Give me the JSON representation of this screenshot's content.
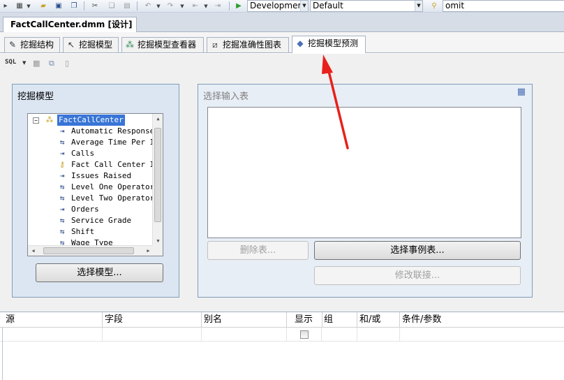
{
  "toolbar": {
    "config_combo": "Developmer",
    "platform_combo": "Default",
    "find_text": "omit"
  },
  "document_tab": {
    "title": "FactCallCenter.dmm [设计]"
  },
  "designer_tabs": [
    {
      "label": "挖掘结构"
    },
    {
      "label": "挖掘模型"
    },
    {
      "label": "挖掘模型查看器"
    },
    {
      "label": "挖掘准确性图表"
    },
    {
      "label": "挖掘模型预测",
      "active": true
    }
  ],
  "sql_toolbar": {
    "sql_label": "SQL"
  },
  "mining_model_panel": {
    "title": "挖掘模型",
    "tree": {
      "root": "FactCallCenter",
      "items": [
        {
          "label": "Automatic Responses",
          "icon": "input-column-icon"
        },
        {
          "label": "Average Time Per Is",
          "icon": "predict-column-icon"
        },
        {
          "label": "Calls",
          "icon": "input-column-icon"
        },
        {
          "label": "Fact Call Center ID",
          "icon": "key-column-icon"
        },
        {
          "label": "Issues Raised",
          "icon": "input-column-icon"
        },
        {
          "label": "Level One Operators",
          "icon": "predict-column-icon"
        },
        {
          "label": "Level Two Operators",
          "icon": "predict-column-icon"
        },
        {
          "label": "Orders",
          "icon": "input-column-icon"
        },
        {
          "label": "Service Grade",
          "icon": "predict-column-icon"
        },
        {
          "label": "Shift",
          "icon": "predict-column-icon"
        },
        {
          "label": "Wage Type",
          "icon": "predict-column-icon"
        }
      ]
    },
    "select_model_button": "选择模型..."
  },
  "input_table_panel": {
    "title": "选择输入表",
    "remove_table_button": "删除表...",
    "select_case_table_button": "选择事例表...",
    "modify_join_button": "修改联接..."
  },
  "grid": {
    "columns": [
      "源",
      "字段",
      "别名",
      "显示",
      "组",
      "和/或",
      "条件/参数"
    ]
  }
}
